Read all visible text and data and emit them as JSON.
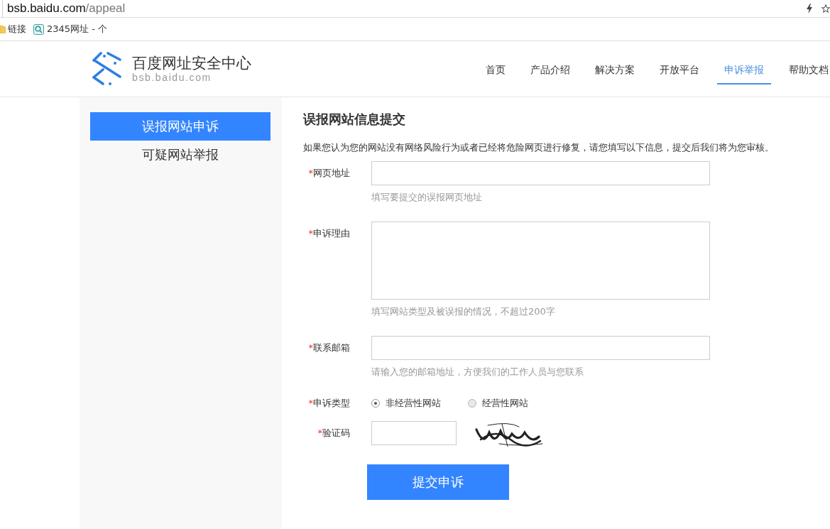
{
  "browser": {
    "url_host": "bsb.baidu.com",
    "url_path": "/appeal",
    "bookmarks": [
      {
        "kind": "folder",
        "label": "链接"
      },
      {
        "kind": "site",
        "label": "2345网址 - 个"
      }
    ]
  },
  "header": {
    "logo_title": "百度网址安全中心",
    "logo_subtitle": "bsb.baidu.com",
    "nav": [
      {
        "label": "首页",
        "selected": false
      },
      {
        "label": "产品介绍",
        "selected": false
      },
      {
        "label": "解决方案",
        "selected": false
      },
      {
        "label": "开放平台",
        "selected": false
      },
      {
        "label": "申诉举报",
        "selected": true
      },
      {
        "label": "帮助文档",
        "selected": false
      }
    ]
  },
  "sidebar": {
    "items": [
      {
        "label": "误报网站申诉",
        "selected": true
      },
      {
        "label": "可疑网站举报",
        "selected": false
      }
    ]
  },
  "form": {
    "title": "误报网站信息提交",
    "intro": "如果您认为您的网站没有网络风险行为或者已经将危险网页进行修复，请您填写以下信息，提交后我们将为您审核。",
    "fields": [
      {
        "kind": "input",
        "marker": "*",
        "label": "网页地址",
        "hint": "填写要提交的误报网页地址"
      },
      {
        "kind": "textarea",
        "marker": "*",
        "label": "申诉理由",
        "hint": "填写网站类型及被误报的情况，不超过200字"
      },
      {
        "kind": "input",
        "marker": "*",
        "label": "联系邮箱",
        "hint": "请输入您的邮箱地址，方便我们的工作人员与您联系"
      },
      {
        "kind": "radio",
        "marker": "*",
        "label": "申诉类型",
        "options": [
          {
            "label": "非经营性网站",
            "selected": true
          },
          {
            "label": "经营性网站",
            "selected": false
          }
        ]
      },
      {
        "kind": "captcha",
        "marker": "*",
        "label": "验证码"
      }
    ],
    "submit": "提交申诉"
  }
}
